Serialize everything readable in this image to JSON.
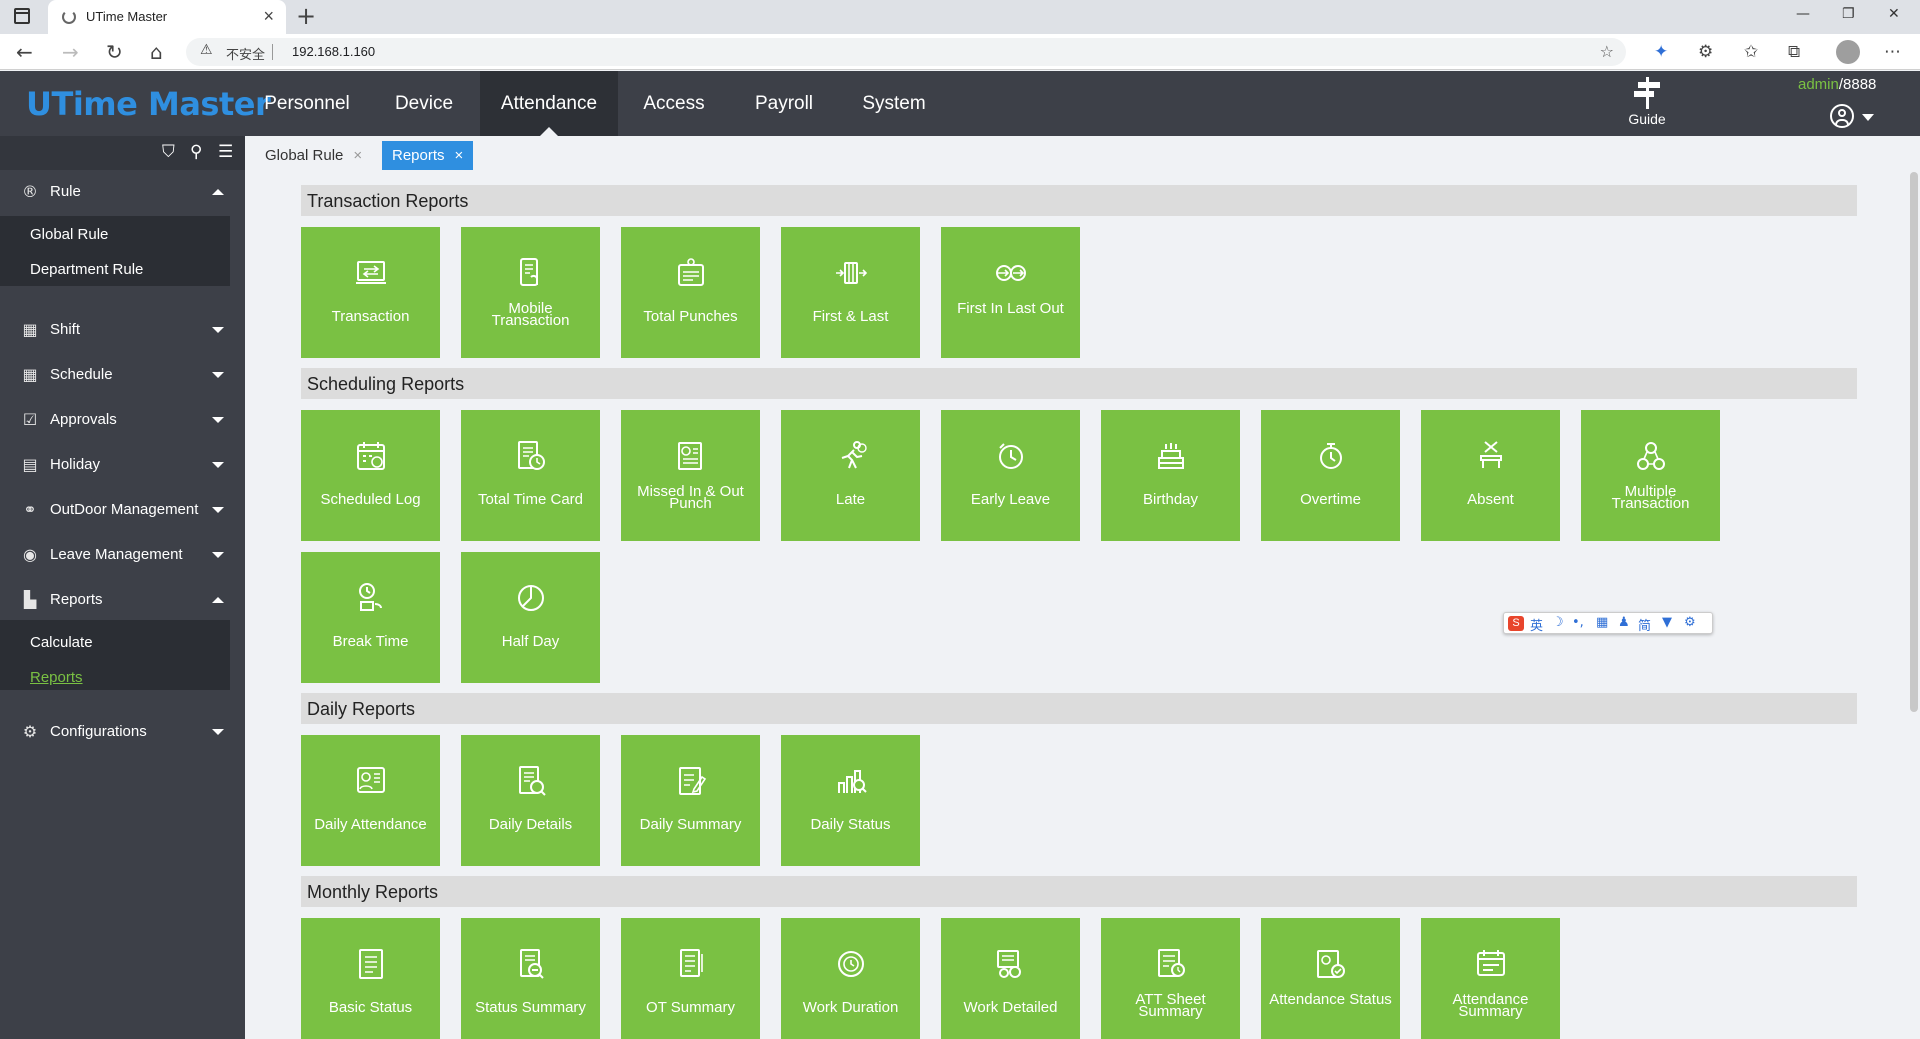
{
  "browser": {
    "tab_title": "UTime Master",
    "tab_close": "×",
    "new_tab": "+",
    "minimize": "—",
    "restore": "❐",
    "close": "✕",
    "address_insecure": "不安全",
    "address_url": "192.168.1.160"
  },
  "app": {
    "logo": "UTime Master",
    "nav": [
      "Personnel",
      "Device",
      "Attendance",
      "Access",
      "Payroll",
      "System"
    ],
    "active_nav": "Attendance",
    "guide_label": "Guide",
    "user_name": "admin",
    "user_id": "/8888"
  },
  "sidebar": {
    "rule": "Rule",
    "rule_items": [
      "Global Rule",
      "Department Rule"
    ],
    "groups": [
      "Shift",
      "Schedule",
      "Approvals",
      "Holiday",
      "OutDoor Management",
      "Leave Management"
    ],
    "reports": "Reports",
    "reports_items": [
      "Calculate",
      "Reports"
    ],
    "configurations": "Configurations"
  },
  "content_tabs": [
    "Global Rule",
    "Reports"
  ],
  "tab_close": "×",
  "sections": {
    "transaction": {
      "title": "Transaction Reports",
      "tiles": [
        "Transaction",
        "Mobile Transaction",
        "Total Punches",
        "First & Last",
        "First In Last Out"
      ]
    },
    "scheduling": {
      "title": "Scheduling Reports",
      "tiles": [
        "Scheduled Log",
        "Total Time Card",
        "Missed In & Out Punch",
        "Late",
        "Early Leave",
        "Birthday",
        "Overtime",
        "Absent",
        "Multiple Transaction",
        "Break Time",
        "Half Day"
      ]
    },
    "daily": {
      "title": "Daily Reports",
      "tiles": [
        "Daily Attendance",
        "Daily Details",
        "Daily Summary",
        "Daily Status"
      ]
    },
    "monthly": {
      "title": "Monthly Reports",
      "tiles": [
        "Basic Status",
        "Status Summary",
        "OT Summary",
        "Work Duration",
        "Work Detailed",
        "ATT Sheet Summary",
        "Attendance Status",
        "Attendance Summary"
      ]
    }
  },
  "ime": {
    "logo": "S",
    "items": [
      "英",
      "☽",
      "•,",
      "▦",
      "♟",
      "简",
      "▼",
      "⚙"
    ]
  },
  "colors": {
    "tile_green": "#7ac143",
    "header_dark": "#3d4048",
    "accent_blue": "#2f8fe0",
    "active_link_green": "#7ac143"
  }
}
